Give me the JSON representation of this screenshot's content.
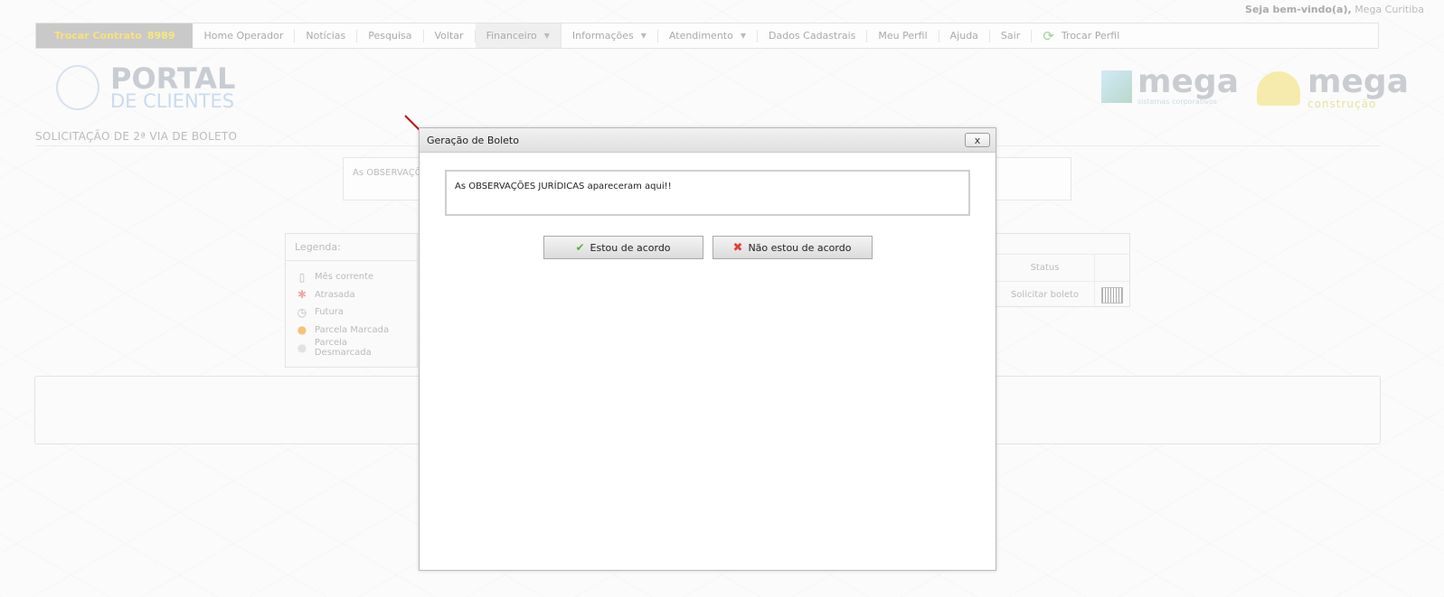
{
  "header": {
    "welcome_label": "Seja bem-vindo(a),",
    "user_name": "Mega Curitiba"
  },
  "navbar": {
    "contract_label": "Trocar Contrato",
    "contract_number": "8989",
    "items": [
      {
        "label": "Home Operador"
      },
      {
        "label": "Notícias"
      },
      {
        "label": "Pesquisa"
      },
      {
        "label": "Voltar"
      },
      {
        "label": "Financeiro"
      },
      {
        "label": "Informações"
      },
      {
        "label": "Atendimento"
      },
      {
        "label": "Dados Cadastrais"
      },
      {
        "label": "Meu Perfil"
      },
      {
        "label": "Ajuda"
      },
      {
        "label": "Sair"
      },
      {
        "label": "Trocar Perfil"
      }
    ]
  },
  "logos": {
    "portal_line1": "PORTAL",
    "portal_line2": "DE CLIENTES",
    "mega1_word": "mega",
    "mega1_sub": "sistemas corporativos",
    "mega2_word": "mega",
    "mega2_sub": "construção"
  },
  "page": {
    "section_title": "SOLICITAÇÃO DE 2ª VIA DE BOLETO",
    "obs_partial": "As OBSERVAÇÕ"
  },
  "legend": {
    "title": "Legenda:",
    "items": [
      {
        "label": "Mês corrente",
        "icon": "calendar-icon"
      },
      {
        "label": "Atrasada",
        "icon": "asterisk-icon"
      },
      {
        "label": "Futura",
        "icon": "clock-icon"
      },
      {
        "label": "Parcela Marcada",
        "icon": "marked-circle-icon"
      },
      {
        "label": "Parcela Desmarcada",
        "icon": "unmarked-circle-icon"
      }
    ]
  },
  "status_table": {
    "header": "Status",
    "row_action": "Solicitar boleto"
  },
  "dialog": {
    "title": "Geração de Boleto",
    "close_symbol": "x",
    "message": "As OBSERVAÇÕES JURÍDICAS apareceram aqui!!",
    "accept_label": "Estou de acordo",
    "reject_label": "Não estou de acordo"
  },
  "colors": {
    "arrow": "#c0121b",
    "accept_icon": "#5ab03a",
    "reject_icon": "#e0403a"
  }
}
